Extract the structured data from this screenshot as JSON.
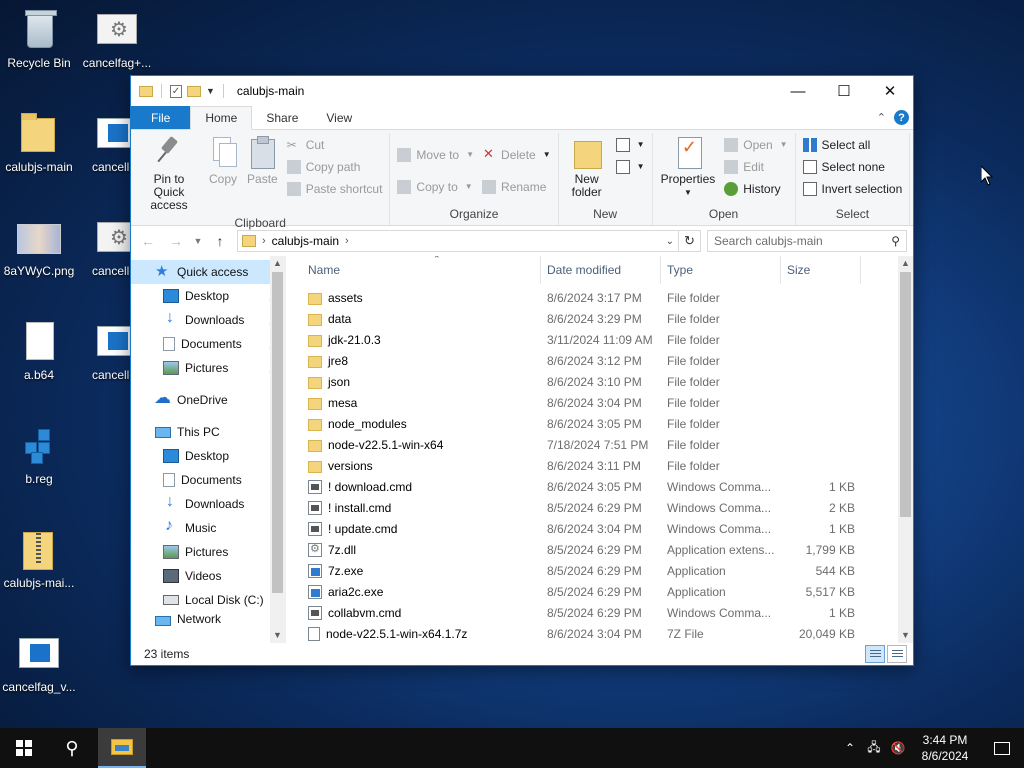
{
  "desktop": {
    "icons": [
      {
        "label": "Recycle Bin",
        "icon": "recycle-bin-icon"
      },
      {
        "label": "cancelfag+...",
        "icon": "settings-shortcut-icon"
      },
      {
        "label": "calubjs-main",
        "icon": "folder-icon"
      },
      {
        "label": "cancellec",
        "icon": "app-window-icon"
      },
      {
        "label": "8aYWyC.png",
        "icon": "image-file-icon"
      },
      {
        "label": "cancellec",
        "icon": "settings-shortcut-icon"
      },
      {
        "label": "a.b64",
        "icon": "blank-file-icon"
      },
      {
        "label": "cancellec",
        "icon": "app-window-icon"
      },
      {
        "label": "b.reg",
        "icon": "registry-file-icon"
      },
      {
        "label": "calubjs-mai...",
        "icon": "zip-folder-icon"
      },
      {
        "label": "cancelfag_v...",
        "icon": "app-window-icon"
      }
    ]
  },
  "window": {
    "title": "calubjs-main",
    "controls": {
      "minimize": "—",
      "maximize": "☐",
      "close": "✕"
    }
  },
  "ribbon": {
    "tabs": {
      "file": "File",
      "home": "Home",
      "share": "Share",
      "view": "View"
    },
    "clipboard": {
      "pin": "Pin to Quick access",
      "copy": "Copy",
      "paste": "Paste",
      "cut": "Cut",
      "copy_path": "Copy path",
      "paste_shortcut": "Paste shortcut",
      "group": "Clipboard"
    },
    "organize": {
      "move_to": "Move to",
      "copy_to": "Copy to",
      "delete": "Delete",
      "rename": "Rename",
      "group": "Organize"
    },
    "new": {
      "new_folder": "New folder",
      "group": "New"
    },
    "open": {
      "properties": "Properties",
      "open": "Open",
      "edit": "Edit",
      "history": "History",
      "group": "Open"
    },
    "select": {
      "select_all": "Select all",
      "select_none": "Select none",
      "invert": "Invert selection",
      "group": "Select"
    }
  },
  "address": {
    "path": "calubjs-main",
    "search_placeholder": "Search calubjs-main"
  },
  "nav": {
    "quick_access": "Quick access",
    "qa_items": [
      "Desktop",
      "Downloads",
      "Documents",
      "Pictures"
    ],
    "onedrive": "OneDrive",
    "this_pc": "This PC",
    "pc_items": [
      "Desktop",
      "Documents",
      "Downloads",
      "Music",
      "Pictures",
      "Videos",
      "Local Disk (C:)"
    ],
    "network": "Network"
  },
  "columns": {
    "name": "Name",
    "date": "Date modified",
    "type": "Type",
    "size": "Size"
  },
  "files": [
    {
      "name": "assets",
      "date": "8/6/2024 3:17 PM",
      "type": "File folder",
      "size": "",
      "icon": "folder"
    },
    {
      "name": "data",
      "date": "8/6/2024 3:29 PM",
      "type": "File folder",
      "size": "",
      "icon": "folder"
    },
    {
      "name": "jdk-21.0.3",
      "date": "3/11/2024 11:09 AM",
      "type": "File folder",
      "size": "",
      "icon": "folder"
    },
    {
      "name": "jre8",
      "date": "8/6/2024 3:12 PM",
      "type": "File folder",
      "size": "",
      "icon": "folder"
    },
    {
      "name": "json",
      "date": "8/6/2024 3:10 PM",
      "type": "File folder",
      "size": "",
      "icon": "folder"
    },
    {
      "name": "mesa",
      "date": "8/6/2024 3:04 PM",
      "type": "File folder",
      "size": "",
      "icon": "folder"
    },
    {
      "name": "node_modules",
      "date": "8/6/2024 3:05 PM",
      "type": "File folder",
      "size": "",
      "icon": "folder"
    },
    {
      "name": "node-v22.5.1-win-x64",
      "date": "7/18/2024 7:51 PM",
      "type": "File folder",
      "size": "",
      "icon": "folder"
    },
    {
      "name": "versions",
      "date": "8/6/2024 3:11 PM",
      "type": "File folder",
      "size": "",
      "icon": "folder"
    },
    {
      "name": "! download.cmd",
      "date": "8/6/2024 3:05 PM",
      "type": "Windows Comma...",
      "size": "1 KB",
      "icon": "cmd"
    },
    {
      "name": "! install.cmd",
      "date": "8/5/2024 6:29 PM",
      "type": "Windows Comma...",
      "size": "2 KB",
      "icon": "cmd"
    },
    {
      "name": "! update.cmd",
      "date": "8/6/2024 3:04 PM",
      "type": "Windows Comma...",
      "size": "1 KB",
      "icon": "cmd"
    },
    {
      "name": "7z.dll",
      "date": "8/5/2024 6:29 PM",
      "type": "Application extens...",
      "size": "1,799 KB",
      "icon": "dll"
    },
    {
      "name": "7z.exe",
      "date": "8/5/2024 6:29 PM",
      "type": "Application",
      "size": "544 KB",
      "icon": "exe"
    },
    {
      "name": "aria2c.exe",
      "date": "8/5/2024 6:29 PM",
      "type": "Application",
      "size": "5,517 KB",
      "icon": "exe"
    },
    {
      "name": "collabvm.cmd",
      "date": "8/5/2024 6:29 PM",
      "type": "Windows Comma...",
      "size": "1 KB",
      "icon": "cmd"
    },
    {
      "name": "node-v22.5.1-win-x64.1.7z",
      "date": "8/6/2024 3:04 PM",
      "type": "7Z File",
      "size": "20,049 KB",
      "icon": "file"
    }
  ],
  "status": {
    "items": "23 items"
  },
  "taskbar": {
    "time": "3:44 PM",
    "date": "8/6/2024"
  }
}
